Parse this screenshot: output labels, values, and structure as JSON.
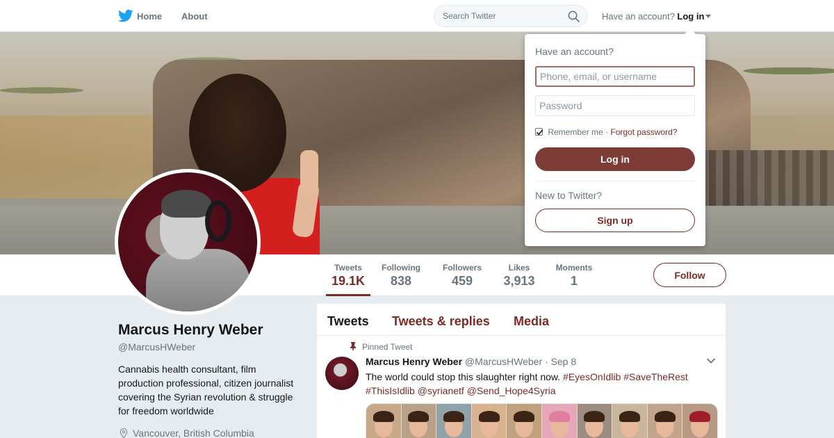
{
  "nav": {
    "logo_icon": "twitter-bird-icon",
    "home_label": "Home",
    "about_label": "About",
    "search_placeholder": "Search Twitter",
    "account_prompt": "Have an account?",
    "login_label": "Log in"
  },
  "profile": {
    "name": "Marcus Henry Weber",
    "handle": "@MarcusHWeber",
    "bio": "Cannabis health consultant, film production professional, citizen journalist covering the Syrian revolution & struggle for freedom worldwide",
    "location": "Vancouver, British Columbia"
  },
  "stats": [
    {
      "label": "Tweets",
      "value": "19.1K",
      "active": true
    },
    {
      "label": "Following",
      "value": "838"
    },
    {
      "label": "Followers",
      "value": "459"
    },
    {
      "label": "Likes",
      "value": "3,913"
    },
    {
      "label": "Moments",
      "value": "1"
    }
  ],
  "follow_label": "Follow",
  "timeline": {
    "tabs": [
      "Tweets",
      "Tweets & replies",
      "Media"
    ],
    "pinned_label": "Pinned Tweet",
    "tweet": {
      "author": "Marcus Henry Weber",
      "handle": "@MarcusHWeber",
      "separator": "·",
      "date": "Sep 8",
      "text": "The world could stop this slaughter right now.",
      "tags_line1": "#EyesOnIdlib #SaveTheRest",
      "tags_line2": "#ThisIsIdlib @syrianetf @Send_Hope4Syria"
    }
  },
  "login_dropdown": {
    "title": "Have an account?",
    "username_placeholder": "Phone, email, or username",
    "password_placeholder": "Password",
    "remember_label": "Remember me",
    "separator": "·",
    "forgot_label": "Forgot password?",
    "login_button": "Log in",
    "new_prompt": "New to Twitter?",
    "signup_button": "Sign up"
  },
  "colors": {
    "accent": "#7d2b24",
    "login_button_bg": "#7d3c35",
    "nav_text": "#66757f"
  }
}
